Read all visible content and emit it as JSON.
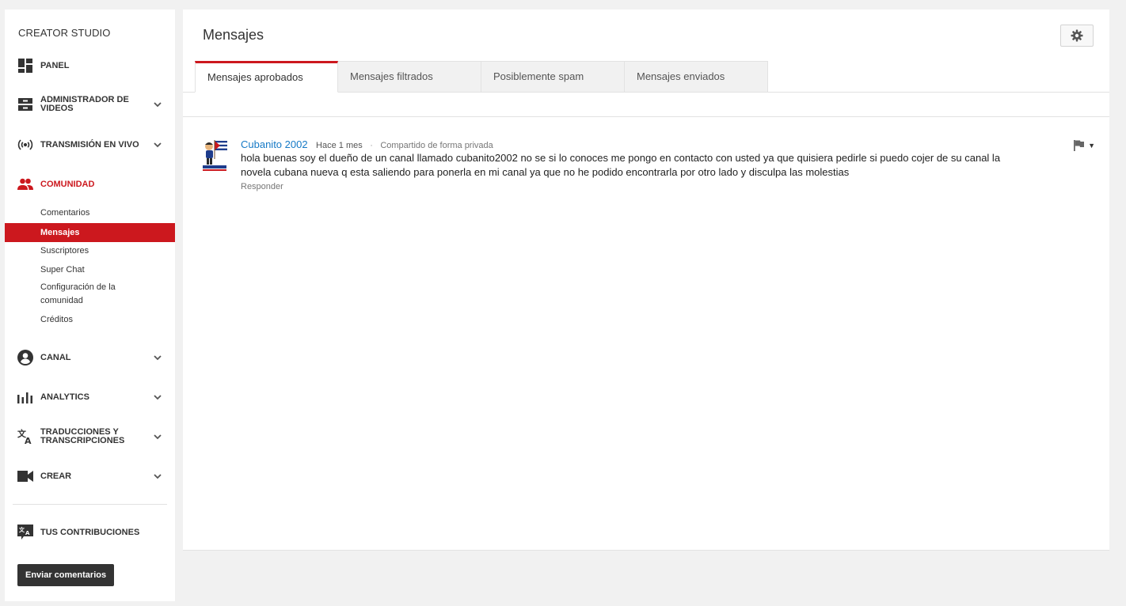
{
  "sidebar": {
    "brand": "CREATOR STUDIO",
    "nav": [
      {
        "label": "PANEL",
        "icon": "dashboard-icon"
      },
      {
        "label": "ADMINISTRADOR DE VIDEOS",
        "icon": "video-manager-icon"
      },
      {
        "label": "TRANSMISIÓN EN VIVO",
        "icon": "live-broadcast-icon"
      },
      {
        "label": "COMUNIDAD",
        "icon": "community-icon"
      },
      {
        "label": "CANAL",
        "icon": "channel-icon"
      },
      {
        "label": "ANALYTICS",
        "icon": "analytics-icon"
      },
      {
        "label": "TRADUCCIONES Y TRANSCRIPCIONES",
        "icon": "translate-icon"
      },
      {
        "label": "CREAR",
        "icon": "create-camera-icon"
      },
      {
        "label": "TUS CONTRIBUCIONES",
        "icon": "contributions-icon"
      }
    ],
    "community_sub": [
      "Comentarios",
      "Mensajes",
      "Suscriptores",
      "Super Chat",
      "Configuración de la comunidad",
      "Créditos"
    ],
    "feedback_button": "Enviar comentarios",
    "active_color": "#cc181e"
  },
  "main": {
    "title": "Mensajes",
    "tabs": [
      "Mensajes aprobados",
      "Mensajes filtrados",
      "Posiblemente spam",
      "Mensajes enviados"
    ],
    "message": {
      "author": "Cubanito 2002",
      "time": "Hace 1 mes",
      "separator": "·",
      "privacy": "Compartido de forma privada",
      "body": "hola buenas soy el dueño de un canal llamado cubanito2002 no se si lo conoces me pongo en contacto con usted ya que quisiera pedirle si puedo cojer de su canal la novela cubana nueva q esta saliendo para ponerla en mi canal ya que no he podido encontrarla por otro lado y disculpa las molestias",
      "reply": "Responder",
      "caret": "▼"
    },
    "link_color": "#167ac6"
  }
}
